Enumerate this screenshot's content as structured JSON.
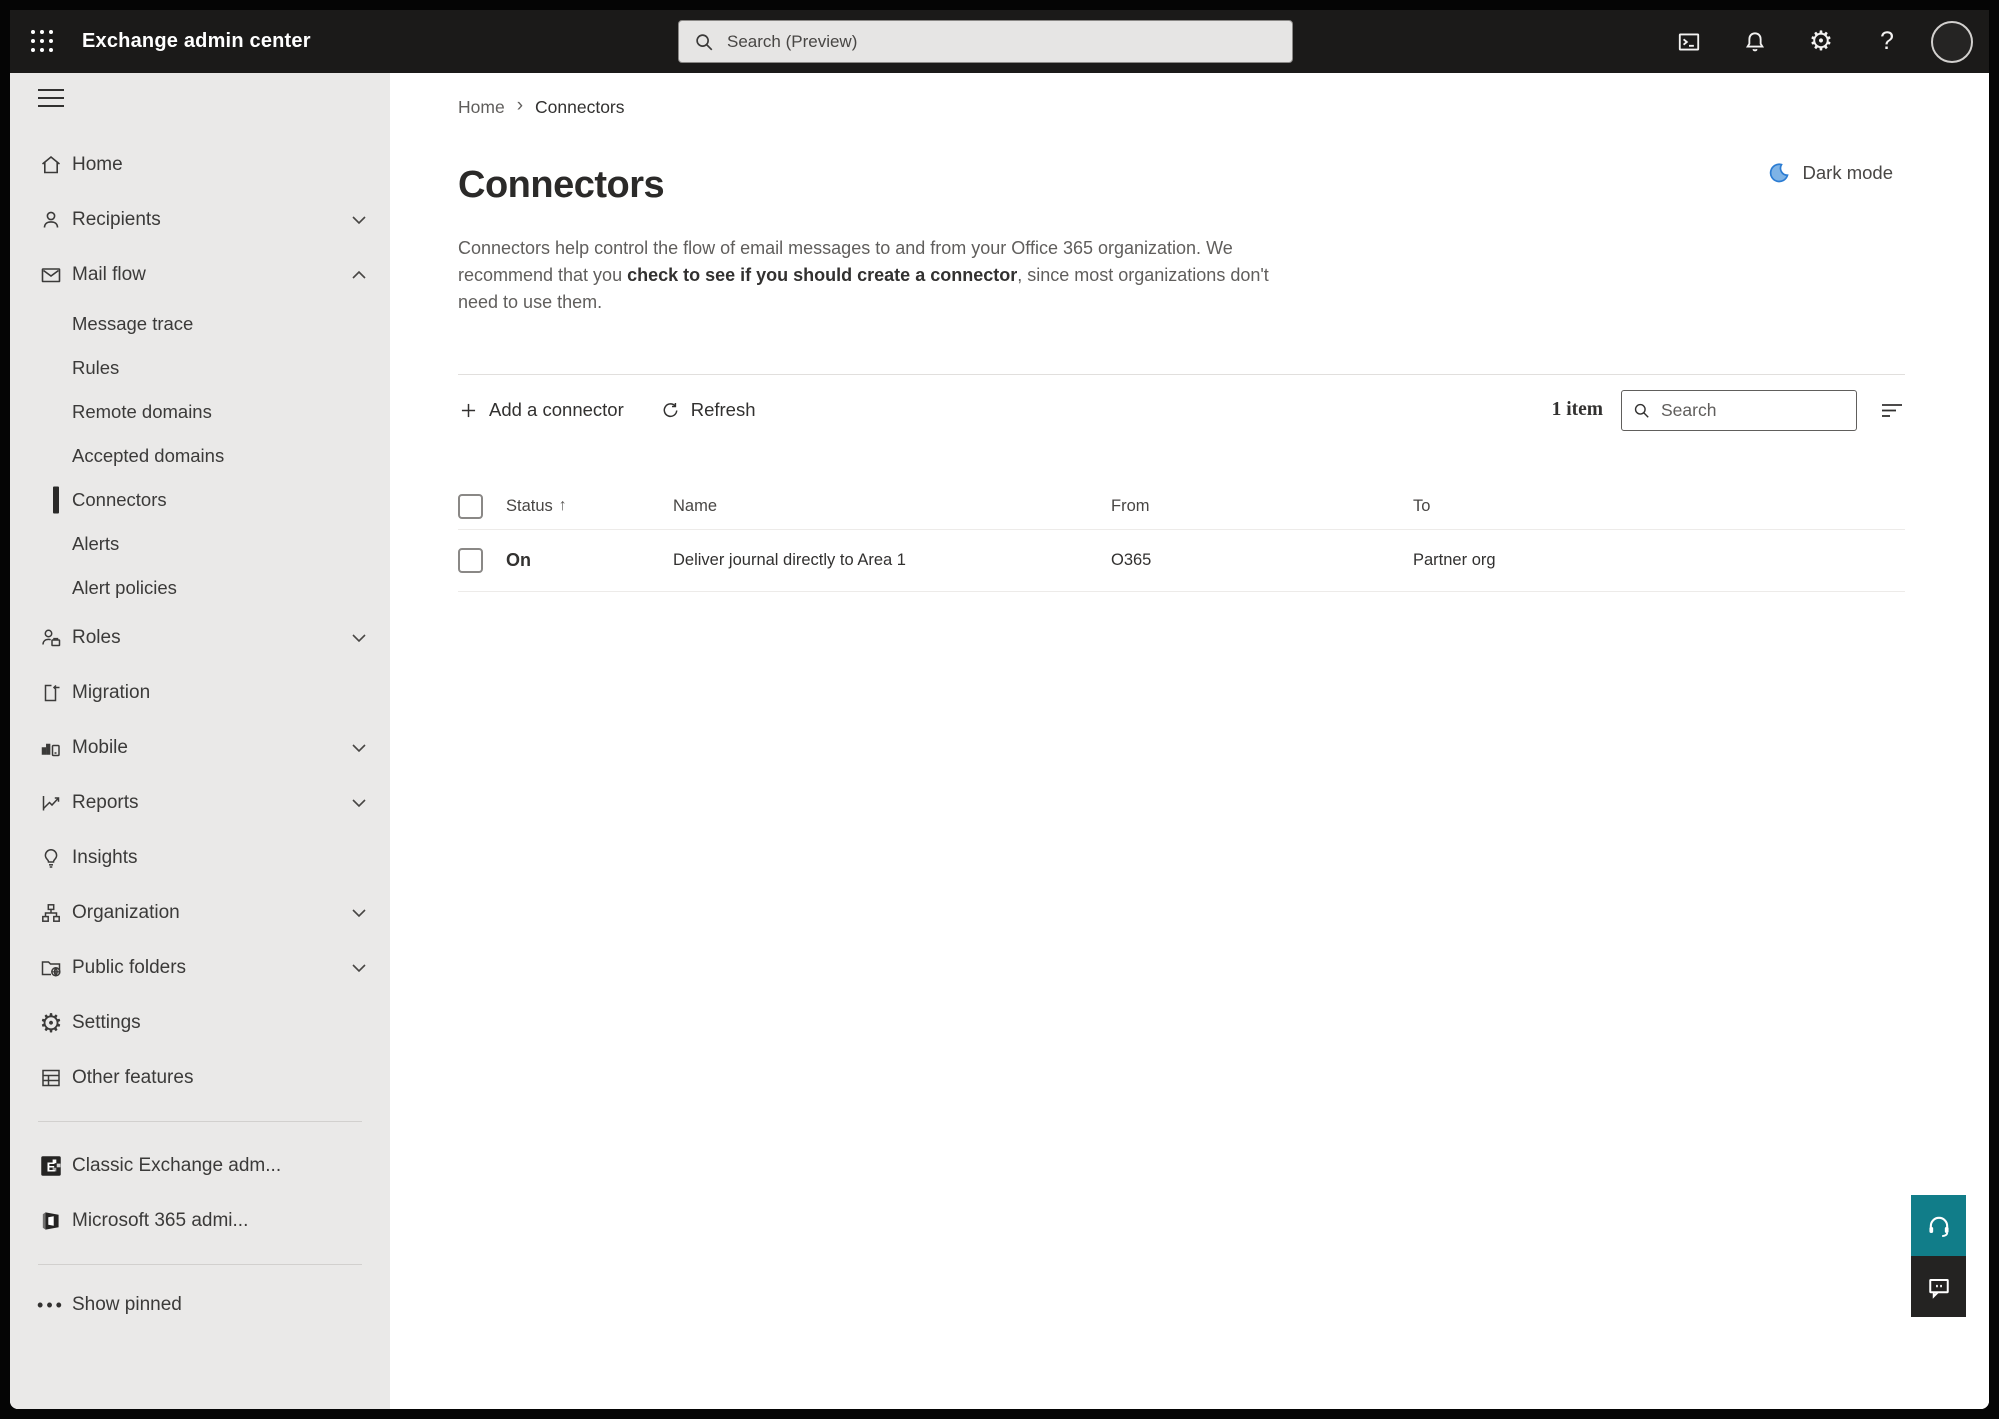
{
  "topbar": {
    "app_title": "Exchange admin center",
    "search_placeholder": "Search (Preview)"
  },
  "sidebar": {
    "items": [
      {
        "label": "Home"
      },
      {
        "label": "Recipients"
      },
      {
        "label": "Mail flow"
      },
      {
        "label": "Message trace"
      },
      {
        "label": "Rules"
      },
      {
        "label": "Remote domains"
      },
      {
        "label": "Accepted domains"
      },
      {
        "label": "Connectors"
      },
      {
        "label": "Alerts"
      },
      {
        "label": "Alert policies"
      },
      {
        "label": "Roles"
      },
      {
        "label": "Migration"
      },
      {
        "label": "Mobile"
      },
      {
        "label": "Reports"
      },
      {
        "label": "Insights"
      },
      {
        "label": "Organization"
      },
      {
        "label": "Public folders"
      },
      {
        "label": "Settings"
      },
      {
        "label": "Other features"
      },
      {
        "label": "Classic Exchange adm..."
      },
      {
        "label": "Microsoft 365 admi..."
      },
      {
        "label": "Show pinned"
      }
    ]
  },
  "breadcrumb": {
    "home": "Home",
    "current": "Connectors"
  },
  "darkmode": {
    "label": "Dark mode"
  },
  "page": {
    "title": "Connectors",
    "description_before": "Connectors help control the flow of email messages to and from your Office 365 organization. We recommend that you ",
    "description_link": "check to see if you should create a connector",
    "description_after": ", since most organizations don't need to use them."
  },
  "toolbar": {
    "add_label": "Add a connector",
    "refresh_label": "Refresh",
    "item_count": "1 item",
    "search_placeholder": "Search"
  },
  "table": {
    "headers": {
      "status": "Status",
      "name": "Name",
      "from": "From",
      "to": "To"
    },
    "rows": [
      {
        "status": "On",
        "name": "Deliver journal directly to Area 1",
        "from": "O365",
        "to": "Partner org"
      }
    ]
  },
  "colors": {
    "topbar_bg": "#1b1a19",
    "sidebar_bg": "#eae9e8",
    "accent_teal": "#117d89",
    "moon_blue": "#2b7cd3"
  }
}
